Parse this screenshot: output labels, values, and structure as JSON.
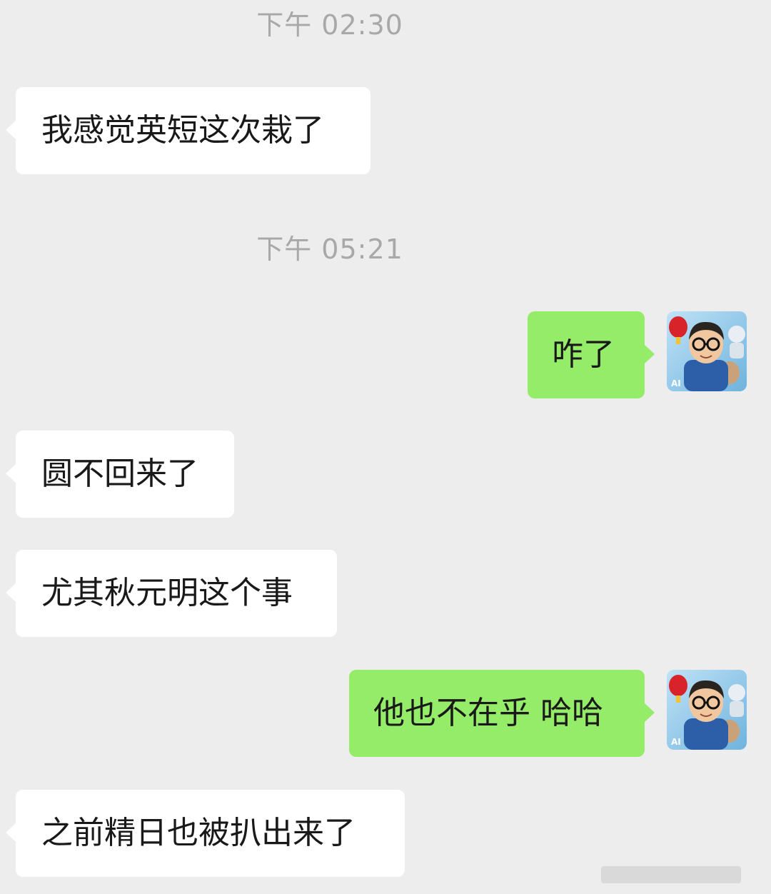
{
  "chat": {
    "timestamps": [
      {
        "text": "下午 02:30"
      },
      {
        "text": "下午 05:21"
      }
    ],
    "messages": [
      {
        "side": "left",
        "text": "我感觉英短这次栽了"
      },
      {
        "side": "right",
        "text": "咋了"
      },
      {
        "side": "left",
        "text": "圆不回来了"
      },
      {
        "side": "left",
        "text": "尤其秋元明这个事"
      },
      {
        "side": "right",
        "text": "他也不在乎 哈哈"
      },
      {
        "side": "left",
        "text": "之前精日也被扒出来了"
      }
    ],
    "avatar": {
      "badge": "AI",
      "icon": "cartoon-man-with-glasses-robot-lantern"
    }
  },
  "colors": {
    "background": "#ededed",
    "incoming_bubble": "#ffffff",
    "outgoing_bubble": "#95ec69",
    "timestamp_text": "#a8a8a8"
  }
}
